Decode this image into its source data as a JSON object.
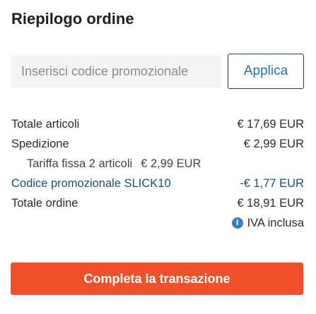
{
  "header": {
    "title": "Riepilogo ordine"
  },
  "promo": {
    "placeholder": "Inserisci codice promozionale",
    "apply_label": "Applica"
  },
  "summary": {
    "subtotal_label": "Totale articoli",
    "subtotal_value": "€ 17,69 EUR",
    "shipping_label": "Spedizione",
    "shipping_value": "€ 2,99 EUR",
    "shipping_detail_label": "Tariffa fissa 2 articoli",
    "shipping_detail_value": "€ 2,99 EUR",
    "promo_label": "Codice promozionale SLICK10",
    "promo_value": "-€ 1,77 EUR",
    "total_label": "Totale ordine",
    "total_value": "€ 18,91 EUR",
    "vat_note": "IVA inclusa"
  },
  "checkout": {
    "label": "Completa la transazione"
  },
  "colors": {
    "accent": "#f0502a",
    "link": "#2b6db0",
    "promo_text": "#1d4e72"
  },
  "icons": {
    "vat_info": "info-icon"
  }
}
